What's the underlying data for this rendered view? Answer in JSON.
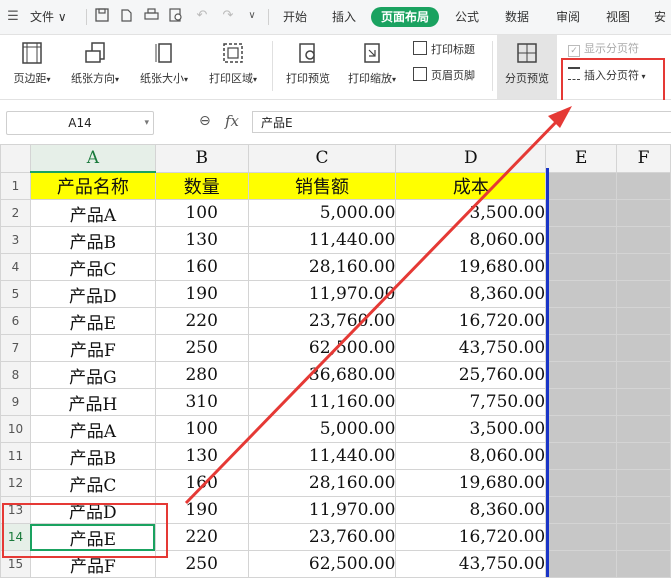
{
  "menu": {
    "file_label": "文件",
    "tabs": [
      {
        "label": "开始"
      },
      {
        "label": "插入"
      },
      {
        "label": "页面布局"
      },
      {
        "label": "公式"
      },
      {
        "label": "数据"
      },
      {
        "label": "审阅"
      },
      {
        "label": "视图"
      },
      {
        "label": "安"
      }
    ]
  },
  "ribbon": {
    "margins": "页边距",
    "orientation": "纸张方向",
    "size": "纸张大小",
    "print_area": "打印区域",
    "print_preview": "打印预览",
    "print_scale": "打印缩放",
    "print_titles": "打印标题",
    "header_footer": "页眉页脚",
    "page_break_preview": "分页预览",
    "show_page_breaks": "显示分页符",
    "insert_page_break": "插入分页符"
  },
  "formula_bar": {
    "name_box": "A14",
    "fx": "fx",
    "content": "产品E"
  },
  "sheet": {
    "columns": [
      "A",
      "B",
      "C",
      "D",
      "E",
      "F"
    ],
    "headers": [
      "产品名称",
      "数量",
      "销售额",
      "成本"
    ],
    "rows": [
      {
        "n": "2",
        "name": "产品A",
        "qty": "100",
        "sales": "5,000.00",
        "cost": "3,500.00"
      },
      {
        "n": "3",
        "name": "产品B",
        "qty": "130",
        "sales": "11,440.00",
        "cost": "8,060.00"
      },
      {
        "n": "4",
        "name": "产品C",
        "qty": "160",
        "sales": "28,160.00",
        "cost": "19,680.00"
      },
      {
        "n": "5",
        "name": "产品D",
        "qty": "190",
        "sales": "11,970.00",
        "cost": "8,360.00"
      },
      {
        "n": "6",
        "name": "产品E",
        "qty": "220",
        "sales": "23,760.00",
        "cost": "16,720.00"
      },
      {
        "n": "7",
        "name": "产品F",
        "qty": "250",
        "sales": "62,500.00",
        "cost": "43,750.00"
      },
      {
        "n": "8",
        "name": "产品G",
        "qty": "280",
        "sales": "36,680.00",
        "cost": "25,760.00"
      },
      {
        "n": "9",
        "name": "产品H",
        "qty": "310",
        "sales": "11,160.00",
        "cost": "7,750.00"
      },
      {
        "n": "10",
        "name": "产品A",
        "qty": "100",
        "sales": "5,000.00",
        "cost": "3,500.00"
      },
      {
        "n": "11",
        "name": "产品B",
        "qty": "130",
        "sales": "11,440.00",
        "cost": "8,060.00"
      },
      {
        "n": "12",
        "name": "产品C",
        "qty": "160",
        "sales": "28,160.00",
        "cost": "19,680.00"
      },
      {
        "n": "13",
        "name": "产品D",
        "qty": "190",
        "sales": "11,970.00",
        "cost": "8,360.00"
      },
      {
        "n": "14",
        "name": "产品E",
        "qty": "220",
        "sales": "23,760.00",
        "cost": "16,720.00"
      },
      {
        "n": "15",
        "name": "产品F",
        "qty": "250",
        "sales": "62,500.00",
        "cost": "43,750.00"
      }
    ]
  },
  "row1_label": "1",
  "colors": {
    "accent": "#1aa260",
    "highlight": "#ffff00",
    "annotation": "#e53935",
    "page_break": "#1a35c6"
  }
}
